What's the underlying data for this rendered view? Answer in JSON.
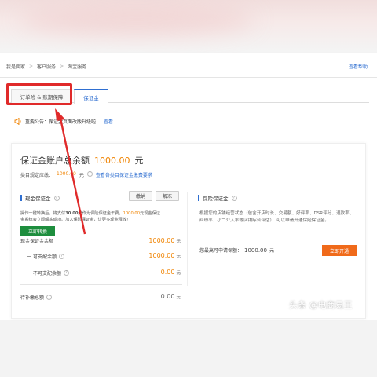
{
  "breadcrumb": {
    "items": [
      "我是卖家",
      "客户服务",
      "淘宝服务"
    ],
    "separator": ">"
  },
  "help_link": "查看帮助",
  "tabs": [
    {
      "label": "订单险 & 账期保障",
      "active": false
    },
    {
      "label": "保证金",
      "active": true
    }
  ],
  "notice": {
    "text": "重要公告：保证金页面改版升级啦！",
    "link": "查看"
  },
  "balance": {
    "title": "保证金账户总余额",
    "amount": "1000.00",
    "unit": "元",
    "required_label": "类目规定应缴：",
    "required_amount": "1000.00",
    "required_unit": "元",
    "requirement_link": "查看各类目保证金缴费要求"
  },
  "cash_section": {
    "title": "现金保证金",
    "buttons": {
      "pay": "缴纳",
      "freeze": "解冻"
    },
    "desc_line1_a": "操作一键转换后，将支付",
    "desc_line1_b": "30.00元",
    "desc_line1_c": "作为保险保证金年费，",
    "desc_line1_d": "1000.00",
    "desc_line1_e": "元现金保证",
    "desc_line2": "金系统会立即解冻成功。加入保险保证金，让更多现金释放！",
    "convert_button": "立即转换",
    "rows": [
      {
        "label": "现金保证金余额",
        "value": "1000.00",
        "unit": "元"
      },
      {
        "label": "可支配余额",
        "value": "1000.00",
        "unit": "元"
      },
      {
        "label": "不可支配余额",
        "value": "0.00",
        "unit": "元"
      }
    ],
    "pending_label": "待补缴总额",
    "pending_value": "0.00",
    "pending_unit": "元"
  },
  "insurance_section": {
    "title": "保险保证金",
    "desc": "根据您的店铺经营状态（包含开店时长、交易额、好评率、DSR评分、退款率、纠纷率、小二介入率等店铺综合评估），可以申请开通保险保证金。",
    "max_label": "您最高可申请保额：",
    "max_value": "1000.00",
    "max_unit": "元",
    "open_button": "立即开通"
  },
  "watermark": "头条 @电商易王",
  "colors": {
    "accent": "#2f6fd1",
    "orange": "#f08300",
    "green": "#1e8e3e",
    "highlight": "#e02a2a"
  }
}
